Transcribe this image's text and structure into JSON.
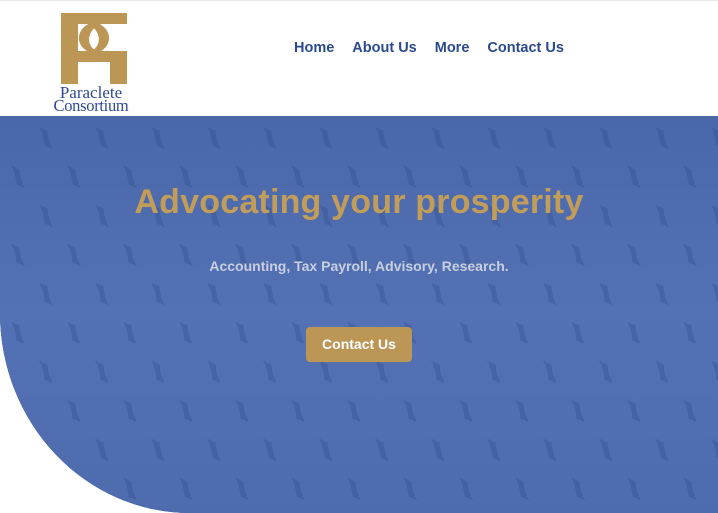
{
  "brand": {
    "line1": "Paraclete",
    "line2": "Consortium",
    "accent_color": "#bb9655",
    "primary_color": "#2b4a8e"
  },
  "nav": {
    "items": [
      {
        "label": "Home"
      },
      {
        "label": "About Us"
      },
      {
        "label": "More"
      },
      {
        "label": "Contact Us"
      }
    ]
  },
  "hero": {
    "title": "Advocating your prosperity",
    "subtitle": "Accounting, Tax Payroll, Advisory, Research.",
    "cta_label": "Contact Us",
    "background_color": "#4a68ab",
    "title_color": "#c29d5a"
  }
}
